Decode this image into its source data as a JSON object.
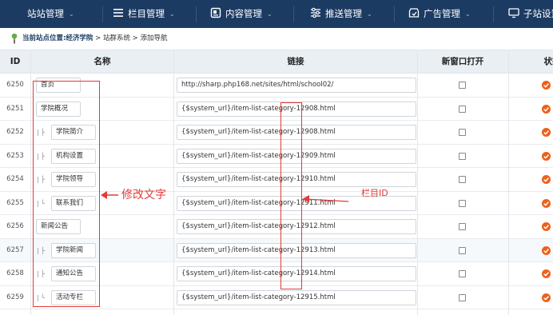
{
  "nav": {
    "items": [
      {
        "label": "站站管理"
      },
      {
        "label": "栏目管理"
      },
      {
        "label": "内容管理"
      },
      {
        "label": "推送管理"
      },
      {
        "label": "广告管理"
      },
      {
        "label": "子站设置"
      }
    ]
  },
  "breadcrumb": {
    "prefix": "当前站点位置:",
    "site": "经济学院",
    "rest": " > 站群系统 > 添加导航"
  },
  "table": {
    "headers": {
      "id": "ID",
      "name": "名称",
      "link": "链接",
      "new_window": "新窗口打开",
      "status": "状态"
    },
    "rows": [
      {
        "id": "6250",
        "level": 0,
        "prefix": "",
        "name": "首页",
        "link": "http://sharp.php168.net/sites/html/school02/",
        "new_window": false
      },
      {
        "id": "6251",
        "level": 0,
        "prefix": "",
        "name": "学院概况",
        "link": "{$system_url}/item-list-category-12908.html",
        "new_window": false
      },
      {
        "id": "6252",
        "level": 1,
        "prefix": "| ├",
        "name": "学院简介",
        "link": "{$system_url}/item-list-category-12908.html",
        "new_window": false
      },
      {
        "id": "6253",
        "level": 1,
        "prefix": "| ├",
        "name": "机构设置",
        "link": "{$system_url}/item-list-category-12909.html",
        "new_window": false
      },
      {
        "id": "6254",
        "level": 1,
        "prefix": "| ├",
        "name": "学院领导",
        "link": "{$system_url}/item-list-category-12910.html",
        "new_window": false
      },
      {
        "id": "6255",
        "level": 1,
        "prefix": "| └",
        "name": "联系我们",
        "link": "{$system_url}/item-list-category-12911.html",
        "new_window": false
      },
      {
        "id": "6256",
        "level": 0,
        "prefix": "",
        "name": "新闻公告",
        "link": "{$system_url}/item-list-category-12912.html",
        "new_window": false
      },
      {
        "id": "6257",
        "level": 1,
        "prefix": "| ├",
        "name": "学院新闻",
        "link": "{$system_url}/item-list-category-12913.html",
        "new_window": false
      },
      {
        "id": "6258",
        "level": 1,
        "prefix": "| ├",
        "name": "通知公告",
        "link": "{$system_url}/item-list-category-12914.html",
        "new_window": false
      },
      {
        "id": "6259",
        "level": 1,
        "prefix": "| └",
        "name": "活动专栏",
        "link": "{$system_url}/item-list-category-12915.html",
        "new_window": false
      }
    ]
  },
  "annotations": {
    "edit_text": "修改文字",
    "column_id": "栏目ID",
    "color": "#e23a3a"
  },
  "colors": {
    "nav_bg": "#1c3b63",
    "header_bg": "#eaeff4",
    "status_on": "#f0601a"
  }
}
